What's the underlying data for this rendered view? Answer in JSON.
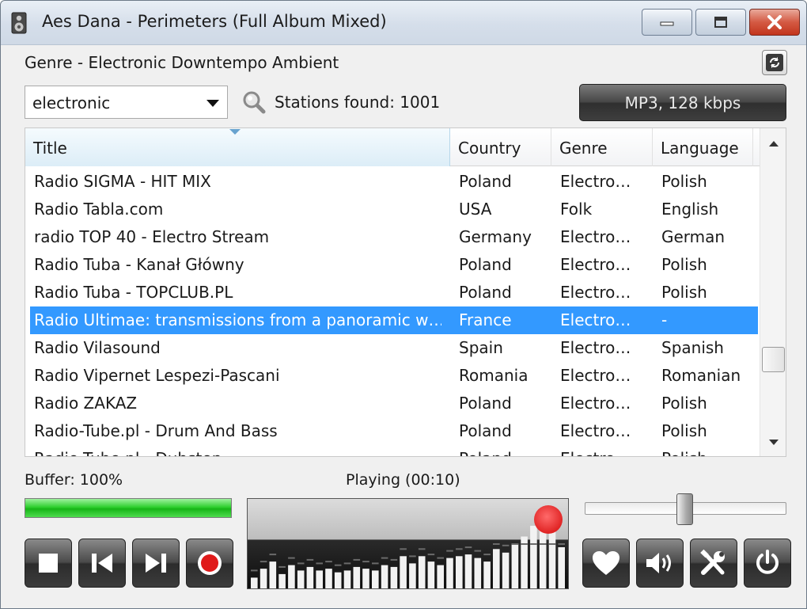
{
  "window": {
    "title": "Aes Dana - Perimeters (Full Album Mixed)"
  },
  "genre_label": "Genre - Electronic Downtempo Ambient",
  "search": {
    "combo_value": "electronic",
    "stations_found": "Stations found: 1001",
    "format": "MP3, 128 kbps"
  },
  "columns": {
    "title": "Title",
    "country": "Country",
    "genre": "Genre",
    "language": "Language"
  },
  "rows": [
    {
      "title": "Radio SIGMA - HIT MIX",
      "country": "Poland",
      "genre": "Electro…",
      "language": "Polish"
    },
    {
      "title": "Radio Tabla.com",
      "country": "USA",
      "genre": "Folk",
      "language": "English"
    },
    {
      "title": "radio TOP 40 - Electro Stream",
      "country": "Germany",
      "genre": "Electro…",
      "language": "German"
    },
    {
      "title": "Radio Tuba - Kanał Główny",
      "country": "Poland",
      "genre": "Electro…",
      "language": "Polish"
    },
    {
      "title": "Radio Tuba - TOPCLUB.PL",
      "country": "Poland",
      "genre": "Electro…",
      "language": "Polish"
    },
    {
      "title": "Radio Ultimae: transmissions from a panoramic w…",
      "country": "France",
      "genre": "Electro…",
      "language": "-"
    },
    {
      "title": "Radio Vilasound",
      "country": "Spain",
      "genre": "Electro…",
      "language": "Spanish"
    },
    {
      "title": "Radio Vipernet Lespezi-Pascani",
      "country": "Romania",
      "genre": "Electro…",
      "language": "Romanian"
    },
    {
      "title": "Radio ZAKAZ",
      "country": "Poland",
      "genre": "Electro…",
      "language": "Polish"
    },
    {
      "title": "Radio-Tube.pl - Drum And Bass",
      "country": "Poland",
      "genre": "Electro…",
      "language": "Polish"
    },
    {
      "title": "Radio-Tube.pl - Dubstep",
      "country": "Poland",
      "genre": "Electro…",
      "language": "Polish"
    }
  ],
  "selected_row": 5,
  "status": {
    "buffer": "Buffer: 100%",
    "buffer_level": 1.0,
    "playing": "Playing (00:10)"
  },
  "volume_level": 0.5,
  "visualizer_levels": [
    0.12,
    0.22,
    0.3,
    0.16,
    0.26,
    0.2,
    0.24,
    0.2,
    0.22,
    0.18,
    0.2,
    0.24,
    0.22,
    0.2,
    0.26,
    0.24,
    0.36,
    0.28,
    0.36,
    0.3,
    0.26,
    0.34,
    0.36,
    0.38,
    0.34,
    0.3,
    0.44,
    0.4,
    0.5,
    0.58,
    0.7,
    0.74,
    0.64,
    0.46
  ],
  "colors": {
    "selection": "#3399ff",
    "buffer_fill": "#2fcf2f",
    "record_dot": "#e02424",
    "button_dark": "#3c3c3c"
  },
  "icons": {
    "stop": "stop-icon",
    "prev": "skip-back-icon",
    "next": "skip-forward-icon",
    "record": "record-icon",
    "favorite": "heart-icon",
    "volume": "speaker-icon",
    "settings": "tools-icon",
    "power": "power-icon",
    "refresh": "refresh-icon",
    "search": "magnifier-icon"
  }
}
